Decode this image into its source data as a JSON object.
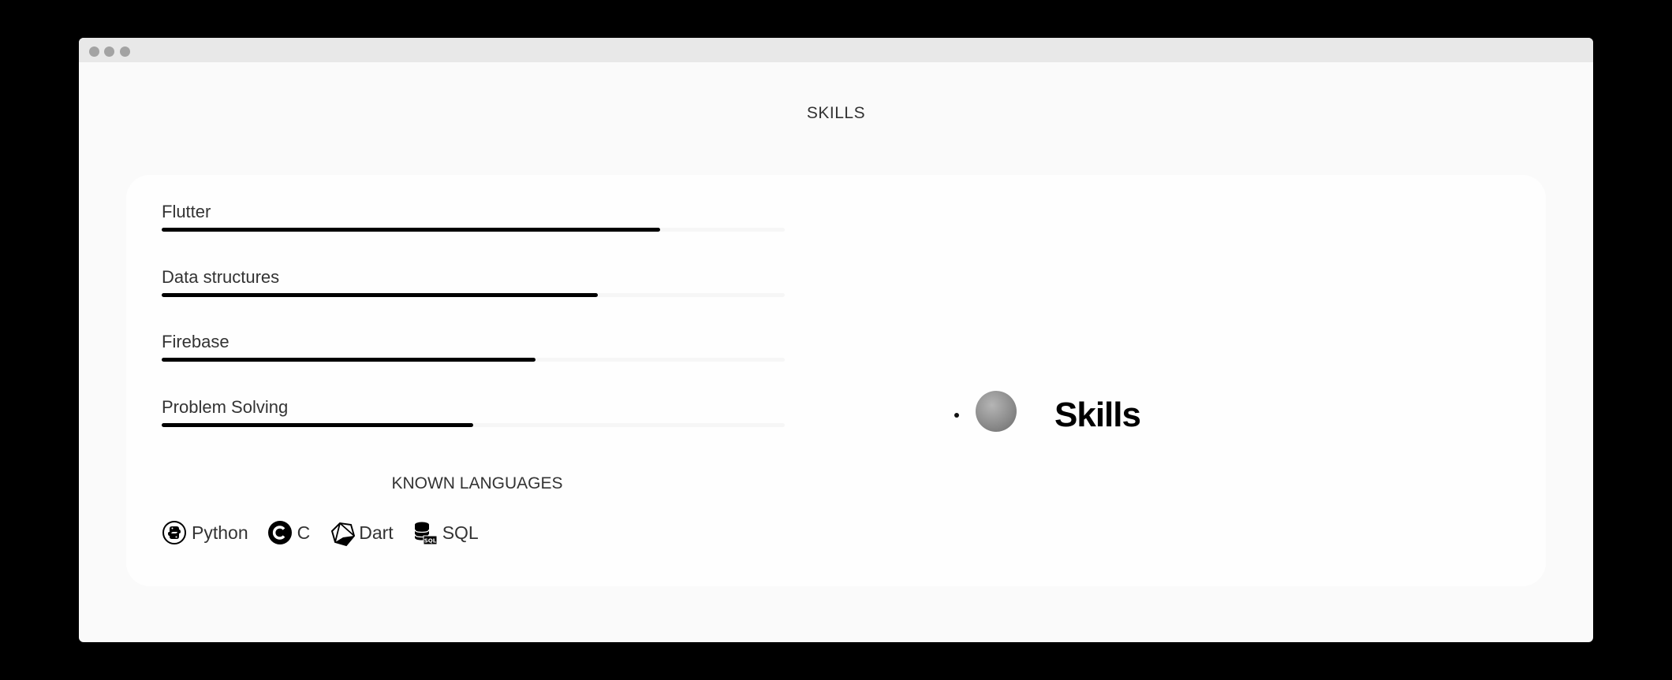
{
  "page": {
    "section_title": "SKILLS"
  },
  "skills": [
    {
      "label": "Flutter",
      "level": 0.8
    },
    {
      "label": "Data structures",
      "level": 0.7
    },
    {
      "label": "Firebase",
      "level": 0.6
    },
    {
      "label": "Problem Solving",
      "level": 0.5
    }
  ],
  "languages": {
    "title": "KNOWN LANGUAGES",
    "items": [
      {
        "label": "Python",
        "icon": "python-icon"
      },
      {
        "label": "C",
        "icon": "c-language-icon"
      },
      {
        "label": "Dart",
        "icon": "dart-icon"
      },
      {
        "label": "SQL",
        "icon": "sql-database-icon"
      }
    ]
  },
  "visual": {
    "heading": "Skills"
  },
  "colors": {
    "bar": "#000000",
    "background": "#fafafa",
    "card": "#fefefe"
  }
}
